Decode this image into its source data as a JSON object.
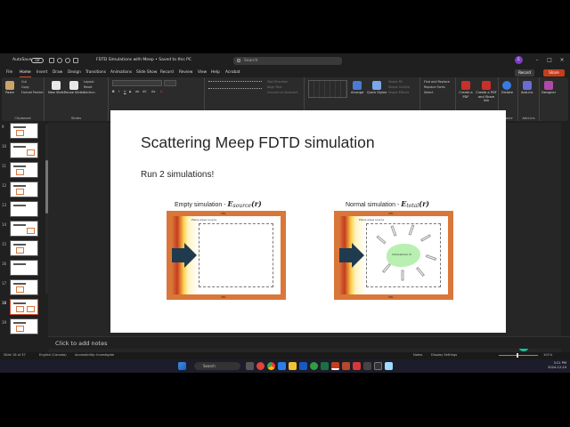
{
  "titlebar": {
    "autosave_label": "AutoSave",
    "autosave_state": "Off",
    "doc_title": "FDTD Simulations with Meep • Saved to this PC",
    "search_placeholder": "Search",
    "user_initial": "E",
    "record_label": "Record",
    "share_label": "Share"
  },
  "tabs": [
    "File",
    "Home",
    "Insert",
    "Draw",
    "Design",
    "Transitions",
    "Animations",
    "Slide Show",
    "Record",
    "Review",
    "View",
    "Help",
    "Acrobat"
  ],
  "active_tab": "Home",
  "ribbon": {
    "groups": [
      {
        "label": "Clipboard",
        "items": [
          "Paste",
          "Cut",
          "Copy",
          "Format Painter"
        ]
      },
      {
        "label": "Slides",
        "items": [
          "New Slide",
          "Reuse Slides",
          "Layout",
          "Reset",
          "Section"
        ]
      },
      {
        "label": "Font",
        "items": [
          "B",
          "I",
          "U",
          "S",
          "ab",
          "AV",
          "Aa",
          "A"
        ]
      },
      {
        "label": "Paragraph",
        "items": [
          "Text Direction",
          "Align Text",
          "Convert to SmartArt"
        ]
      },
      {
        "label": "Drawing",
        "items": [
          "Arrange",
          "Quick Styles",
          "Shape Fill",
          "Shape Outline",
          "Shape Effects"
        ]
      },
      {
        "label": "Editing",
        "items": [
          "Find and Replace",
          "Replace Fonts",
          "Select"
        ]
      },
      {
        "label": "Adobe Acrobat",
        "items": [
          "Create a PDF",
          "Create a PDF and Share link"
        ]
      },
      {
        "label": "Voice",
        "items": [
          "Dictate"
        ]
      },
      {
        "label": "Add-ins",
        "items": [
          "Add-ins"
        ]
      },
      {
        "label": "",
        "items": [
          "Designer"
        ]
      }
    ]
  },
  "thumbnails": {
    "numbers": [
      "9",
      "10",
      "11",
      "12",
      "13",
      "14",
      "15",
      "16",
      "17",
      "18",
      "19"
    ],
    "selected": "18"
  },
  "slide": {
    "title": "Scattering Meep FDTD simulation",
    "subtitle": "Run 2 simulations!",
    "left": {
      "caption_prefix": "Empty simulation - ",
      "field_symbol": "E",
      "field_sub": "source",
      "field_arg": "(r)",
      "top_label": "PML",
      "inner_label": "Plane-wave source",
      "bottom_label": "PML"
    },
    "right": {
      "caption_prefix": "Normal simulation - ",
      "field_symbol": "E",
      "field_sub": "total",
      "field_arg": "(r)",
      "top_label": "PML",
      "inner_label": "Plane-wave source",
      "bottom_label": "PML",
      "scatterer_label": "Intracellular IV"
    }
  },
  "notes_placeholder": "Click to add notes",
  "status": {
    "slide_pos": "Slide 18 of 37",
    "language": "English (Canada)",
    "accessibility": "Accessibility: Investigate",
    "notes": "Notes",
    "display_settings": "Display Settings",
    "zoom": "101%"
  },
  "taskbar": {
    "search_label": "Search",
    "time": "3:21 PM",
    "date": "2024-12-24"
  },
  "colors": {
    "accent": "#d35230",
    "pml_orange": "#d9773a",
    "source_arrow": "#1f3b4d",
    "scatterer": "#b7f0b0"
  },
  "icons": [
    "search-icon",
    "save-icon",
    "undo-icon",
    "redo-icon",
    "grammarly-icon",
    "windows-icon"
  ]
}
